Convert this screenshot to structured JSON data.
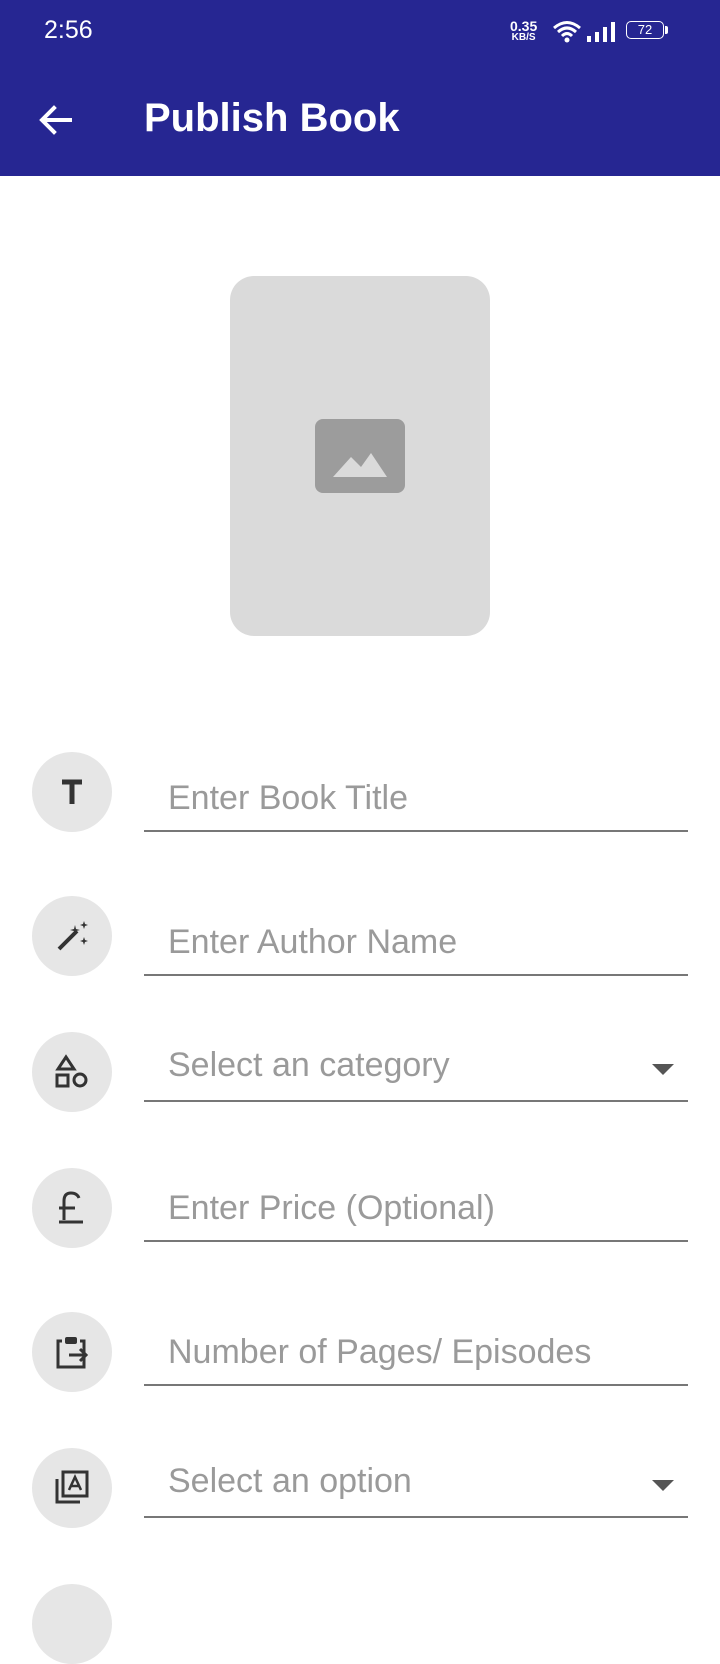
{
  "status_bar": {
    "time": "2:56",
    "net_speed_value": "0.35",
    "net_speed_unit": "KB/S",
    "battery_level": "72",
    "icons": [
      "wifi-icon",
      "signal-icon",
      "battery-icon"
    ]
  },
  "app_bar": {
    "title": "Publish Book",
    "back_icon": "arrow-left-icon",
    "color": "#262692"
  },
  "cover": {
    "icon": "image-placeholder-icon"
  },
  "form": {
    "title": {
      "placeholder": "Enter Book Title",
      "icon": "text-title-icon"
    },
    "author": {
      "placeholder": "Enter Author Name",
      "icon": "magic-wand-icon"
    },
    "category": {
      "value": "Select an category",
      "icon": "shapes-icon"
    },
    "price": {
      "placeholder": "Enter Price (Optional)",
      "icon": "pound-icon"
    },
    "pages": {
      "placeholder": "Number of Pages/ Episodes",
      "icon": "clipboard-arrow-icon"
    },
    "option": {
      "value": "Select an option",
      "icon": "library-icon"
    }
  }
}
